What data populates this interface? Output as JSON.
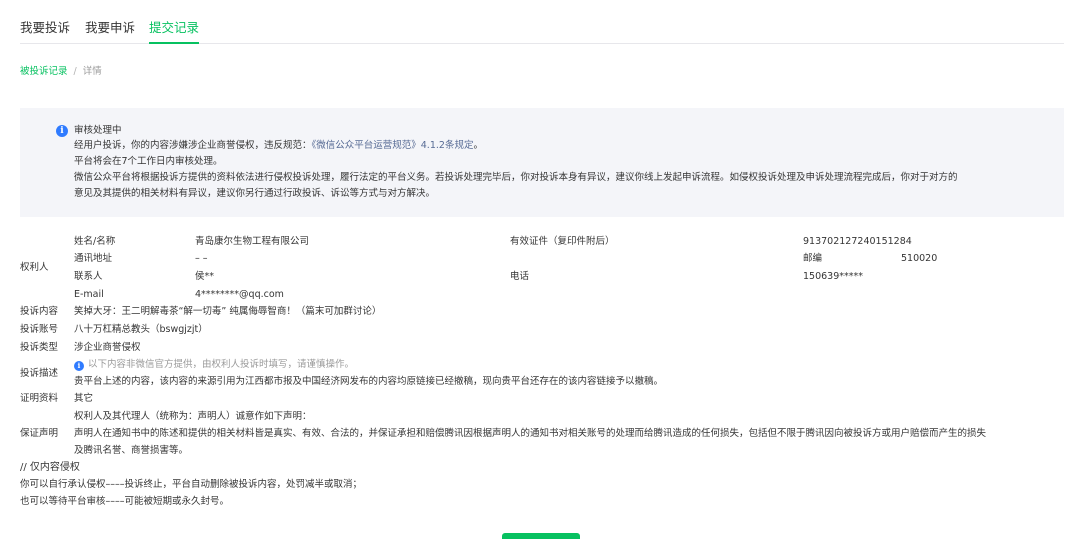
{
  "tabs": [
    {
      "label": "我要投诉"
    },
    {
      "label": "我要申诉"
    },
    {
      "label": "提交记录"
    }
  ],
  "breadcrumb": {
    "link": "被投诉记录",
    "sep": "/",
    "current": "详情"
  },
  "notice": {
    "title": "审核处理中",
    "line1_prefix": "经用户投诉，你的内容涉嫌涉企业商誉侵权，违反规范：",
    "line1_link": "《微信公众平台运营规范》4.1.2条规定",
    "line1_suffix": "。",
    "line2": "平台将会在7个工作日内审核处理。",
    "line3": "微信公众平台将根据投诉方提供的资料依法进行侵权投诉处理，履行法定的平台义务。若投诉处理完毕后，你对投诉本身有异议，建议你线上发起申诉流程。如侵权投诉处理及申诉处理流程完成后，你对于对方的",
    "line4": "意见及其提供的相关材料有异议，建议你另行通过行政投诉、诉讼等方式与对方解决。"
  },
  "rights": {
    "section_label": "权利人",
    "name_label": "姓名/名称",
    "name_value": "青岛康尔生物工程有限公司",
    "cert_label": "有效证件（复印件附后）",
    "cert_value": "913702127240151284",
    "address_label": "通讯地址",
    "address_value": "– –",
    "postcode_label": "邮编",
    "postcode_value": "510020",
    "contact_label": "联系人",
    "contact_value": "侯**",
    "phone_label": "电话",
    "phone_value": "150639*****",
    "email_label": "E-mail",
    "email_value": "4********@qq.com"
  },
  "details": {
    "content_label": "投诉内容",
    "content_value": "笑掉大牙：王二明解毒茶“解一切毒” 纯属侮辱智商！（篇末可加群讨论）",
    "account_label": "投诉账号",
    "account_value": "八十万杠精总教头（bswgjzjt）",
    "type_label": "投诉类型",
    "type_value": "涉企业商誉侵权",
    "desc_label": "投诉描述",
    "desc_hint": "以下内容非微信官方提供，由权利人投诉时填写，请谨慎操作。",
    "desc_value": "贵平台上述的内容，该内容的来源引用为江西都市报及中国经济网发布的内容均原链接已经撤稿，现向贵平台还存在的该内容链接予以撤稿。",
    "proof_label": "证明资料",
    "proof_value": "其它",
    "guarantee_label": "保证声明",
    "guarantee_line1": "权利人及其代理人（统称为：声明人）诚意作如下声明：",
    "guarantee_line2": "声明人在通知书中的陈述和提供的相关材料皆是真实、有效、合法的，并保证承担和赔偿腾讯因根据声明人的通知书对相关账号的处理而给腾讯造成的任何损失，包括但不限于腾讯因向被投诉方或用户赔偿而产生的损失",
    "guarantee_line3": "及腾讯名誉、商誉损害等。"
  },
  "footer_notes": [
    "// 仅内容侵权",
    "你可以自行承认侵权––––投诉终止，平台自动删除被投诉内容，处罚减半或取消；",
    "也可以等待平台审核––––可能被短期或永久封号。"
  ],
  "colors": {
    "accent": "#07c160",
    "link": "#576b95",
    "info": "#2f7bff"
  }
}
